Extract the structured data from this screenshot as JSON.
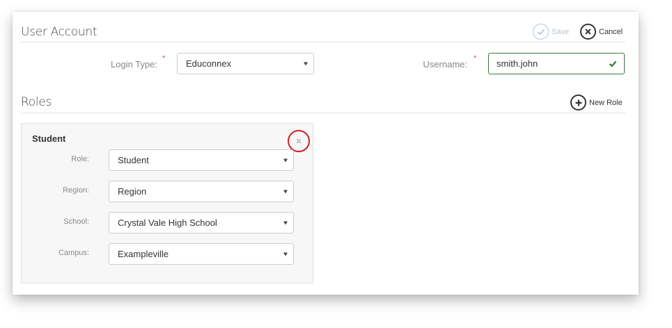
{
  "user_account": {
    "title": "User Account",
    "save_label": "Save",
    "cancel_label": "Cancel",
    "login_type": {
      "label": "Login Type:",
      "value": "Educonnex"
    },
    "username": {
      "label": "Username:",
      "value": "smith.john"
    }
  },
  "roles": {
    "title": "Roles",
    "new_role_label": "New Role",
    "cards": [
      {
        "title": "Student",
        "role": {
          "label": "Role:",
          "value": "Student"
        },
        "region": {
          "label": "Region:",
          "value": "Region"
        },
        "school": {
          "label": "School:",
          "value": "Crystal Vale High School"
        },
        "campus": {
          "label": "Campus:",
          "value": "Exampleville"
        }
      }
    ]
  },
  "colors": {
    "required_asterisk": "#d9534f",
    "valid_green": "#3c763d",
    "highlight_ring": "#cc1f1f"
  },
  "icons": {
    "save": "check-circle-icon",
    "cancel": "x-circle-icon",
    "new_role": "plus-circle-icon",
    "remove_card": "close-icon",
    "valid": "checkmark-icon"
  }
}
